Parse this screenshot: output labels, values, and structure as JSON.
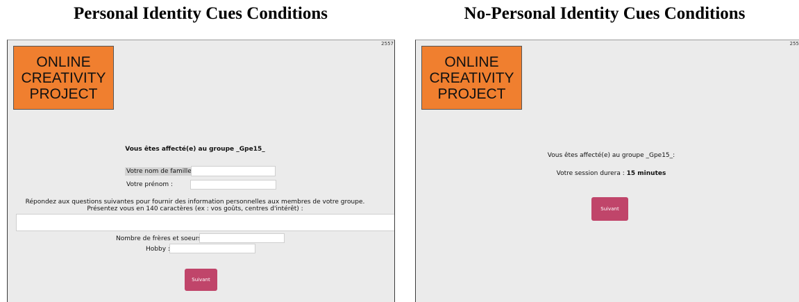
{
  "left": {
    "heading": "Personal Identity Cues Conditions",
    "panel_id": "2557",
    "logo": [
      "ONLINE",
      "CREATIVITY",
      "PROJECT"
    ],
    "group_text": "Vous êtes affecté(e) au groupe _Gpe15_",
    "last_name_label": "Votre nom de famille :",
    "first_name_label": "Votre prénom :",
    "instructions_line1": "Répondez aux questions suivantes pour fournir des information personnelles aux membres de votre groupe.",
    "instructions_line2": "Présentez vous en 140 caractères (ex : vos goûts, centres d'intérêt) :",
    "siblings_label": "Nombre de frères et soeurs :",
    "hobby_label": "Hobby :",
    "button_label": "Suivant"
  },
  "right": {
    "heading": "No-Personal Identity Cues Conditions",
    "panel_id": "255",
    "logo": [
      "ONLINE",
      "CREATIVITY",
      "PROJECT"
    ],
    "group_text": "Vous êtes affecté(e) au groupe _Gpe15_:",
    "session_label": "Votre session durera : ",
    "session_value": "15 minutes",
    "button_label": "Suivant"
  }
}
